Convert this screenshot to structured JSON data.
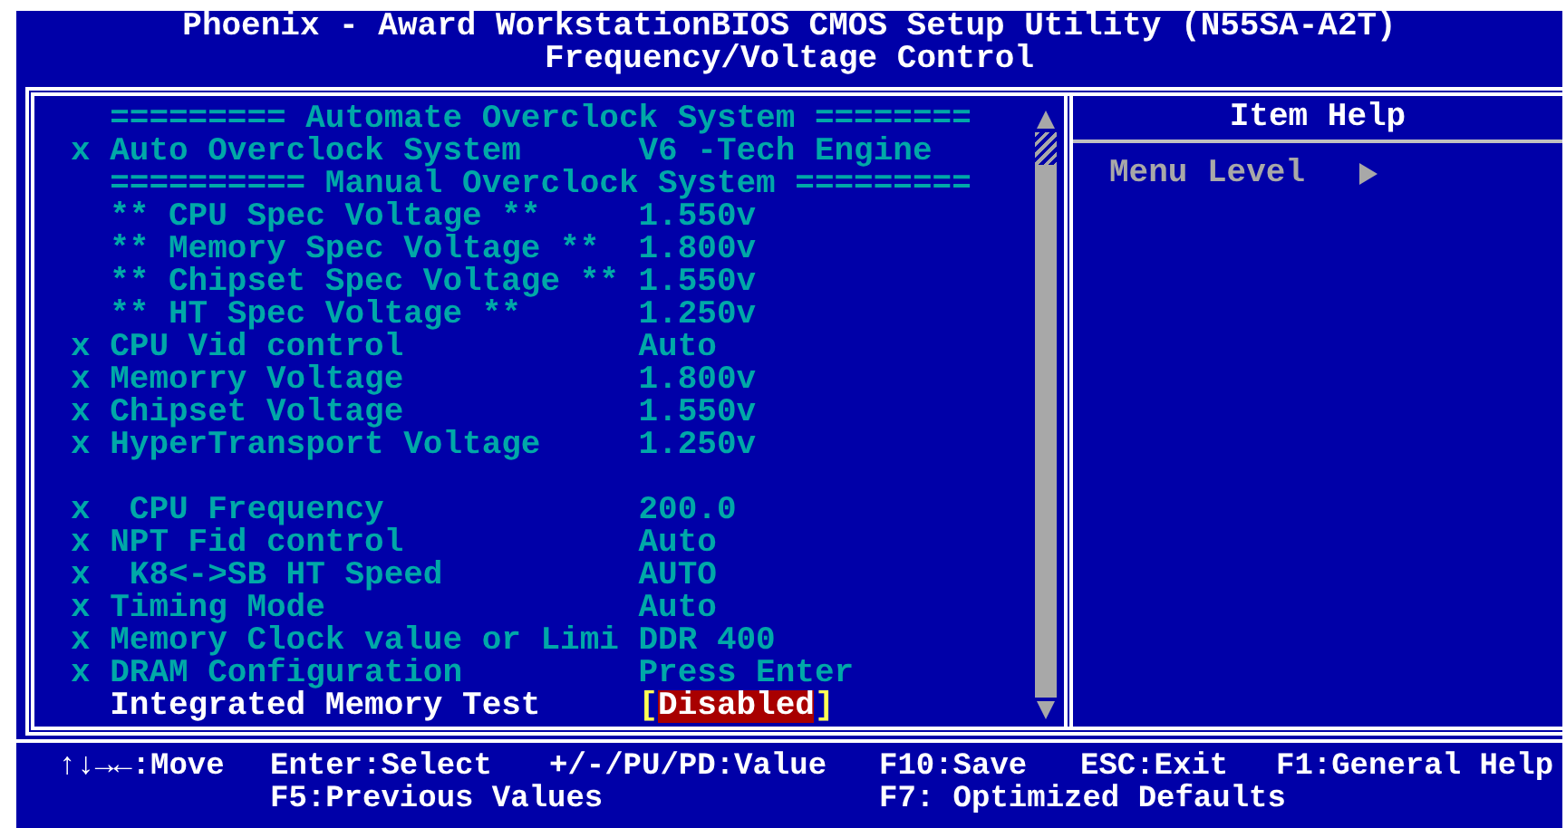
{
  "title": {
    "line1": "Phoenix - Award WorkstationBIOS CMOS Setup Utility (N55SA-A2T)",
    "line2": "Frequency/Voltage Control"
  },
  "settings": [
    {
      "kind": "heading",
      "label": "========= Automate Overclock System ========"
    },
    {
      "kind": "option",
      "marker": "x",
      "label": "Auto Overclock System",
      "value": "V6 -Tech Engine",
      "selected": false
    },
    {
      "kind": "heading",
      "label": "========== Manual Overclock System ========="
    },
    {
      "kind": "option",
      "label": "** CPU Spec Voltage **",
      "value": "1.550v",
      "selected": false
    },
    {
      "kind": "option",
      "label": "** Memory Spec Voltage **",
      "value": "1.800v",
      "selected": false
    },
    {
      "kind": "option",
      "label": "** Chipset Spec Voltage **",
      "value": "1.550v",
      "selected": false
    },
    {
      "kind": "option",
      "label": "** HT Spec Voltage **",
      "value": "1.250v",
      "selected": false
    },
    {
      "kind": "option",
      "marker": "x",
      "label": "CPU Vid control",
      "value": "Auto",
      "selected": false
    },
    {
      "kind": "option",
      "marker": "x",
      "label": "Memorry Voltage",
      "value": "1.800v",
      "selected": false
    },
    {
      "kind": "option",
      "marker": "x",
      "label": "Chipset Voltage",
      "value": "1.550v",
      "selected": false
    },
    {
      "kind": "option",
      "marker": "x",
      "label": "HyperTransport Voltage",
      "value": "1.250v",
      "selected": false
    },
    {
      "kind": "blank"
    },
    {
      "kind": "option",
      "marker": "x",
      "label": " CPU Frequency",
      "value": "200.0",
      "selected": false
    },
    {
      "kind": "option",
      "marker": "x",
      "label": "NPT Fid control",
      "value": "Auto",
      "selected": false
    },
    {
      "kind": "option",
      "marker": "x",
      "label": " K8<->SB HT Speed",
      "value": "AUTO",
      "selected": false
    },
    {
      "kind": "option",
      "marker": "x",
      "label": "Timing Mode",
      "value": "Auto",
      "selected": false
    },
    {
      "kind": "option",
      "marker": "x",
      "label": "Memory Clock value or Limi",
      "value": "DDR 400",
      "selected": false
    },
    {
      "kind": "option",
      "marker": "x",
      "label": "DRAM Configuration",
      "value": "Press Enter",
      "selected": false
    },
    {
      "kind": "option",
      "label": "Integrated Memory Test",
      "value": "Disabled",
      "bracket_left": "[",
      "bracket_right": "]",
      "selected": true
    }
  ],
  "item_help": {
    "title": "Item Help",
    "menu_level": "Menu Level"
  },
  "footer": {
    "line1": [
      "↑↓→←:Move",
      "Enter:Select",
      "+/-/PU/PD:Value",
      "F10:Save",
      "ESC:Exit",
      "F1:General Help"
    ],
    "line2": [
      "F5:Previous Values",
      "F7: Optimized Defaults"
    ]
  }
}
